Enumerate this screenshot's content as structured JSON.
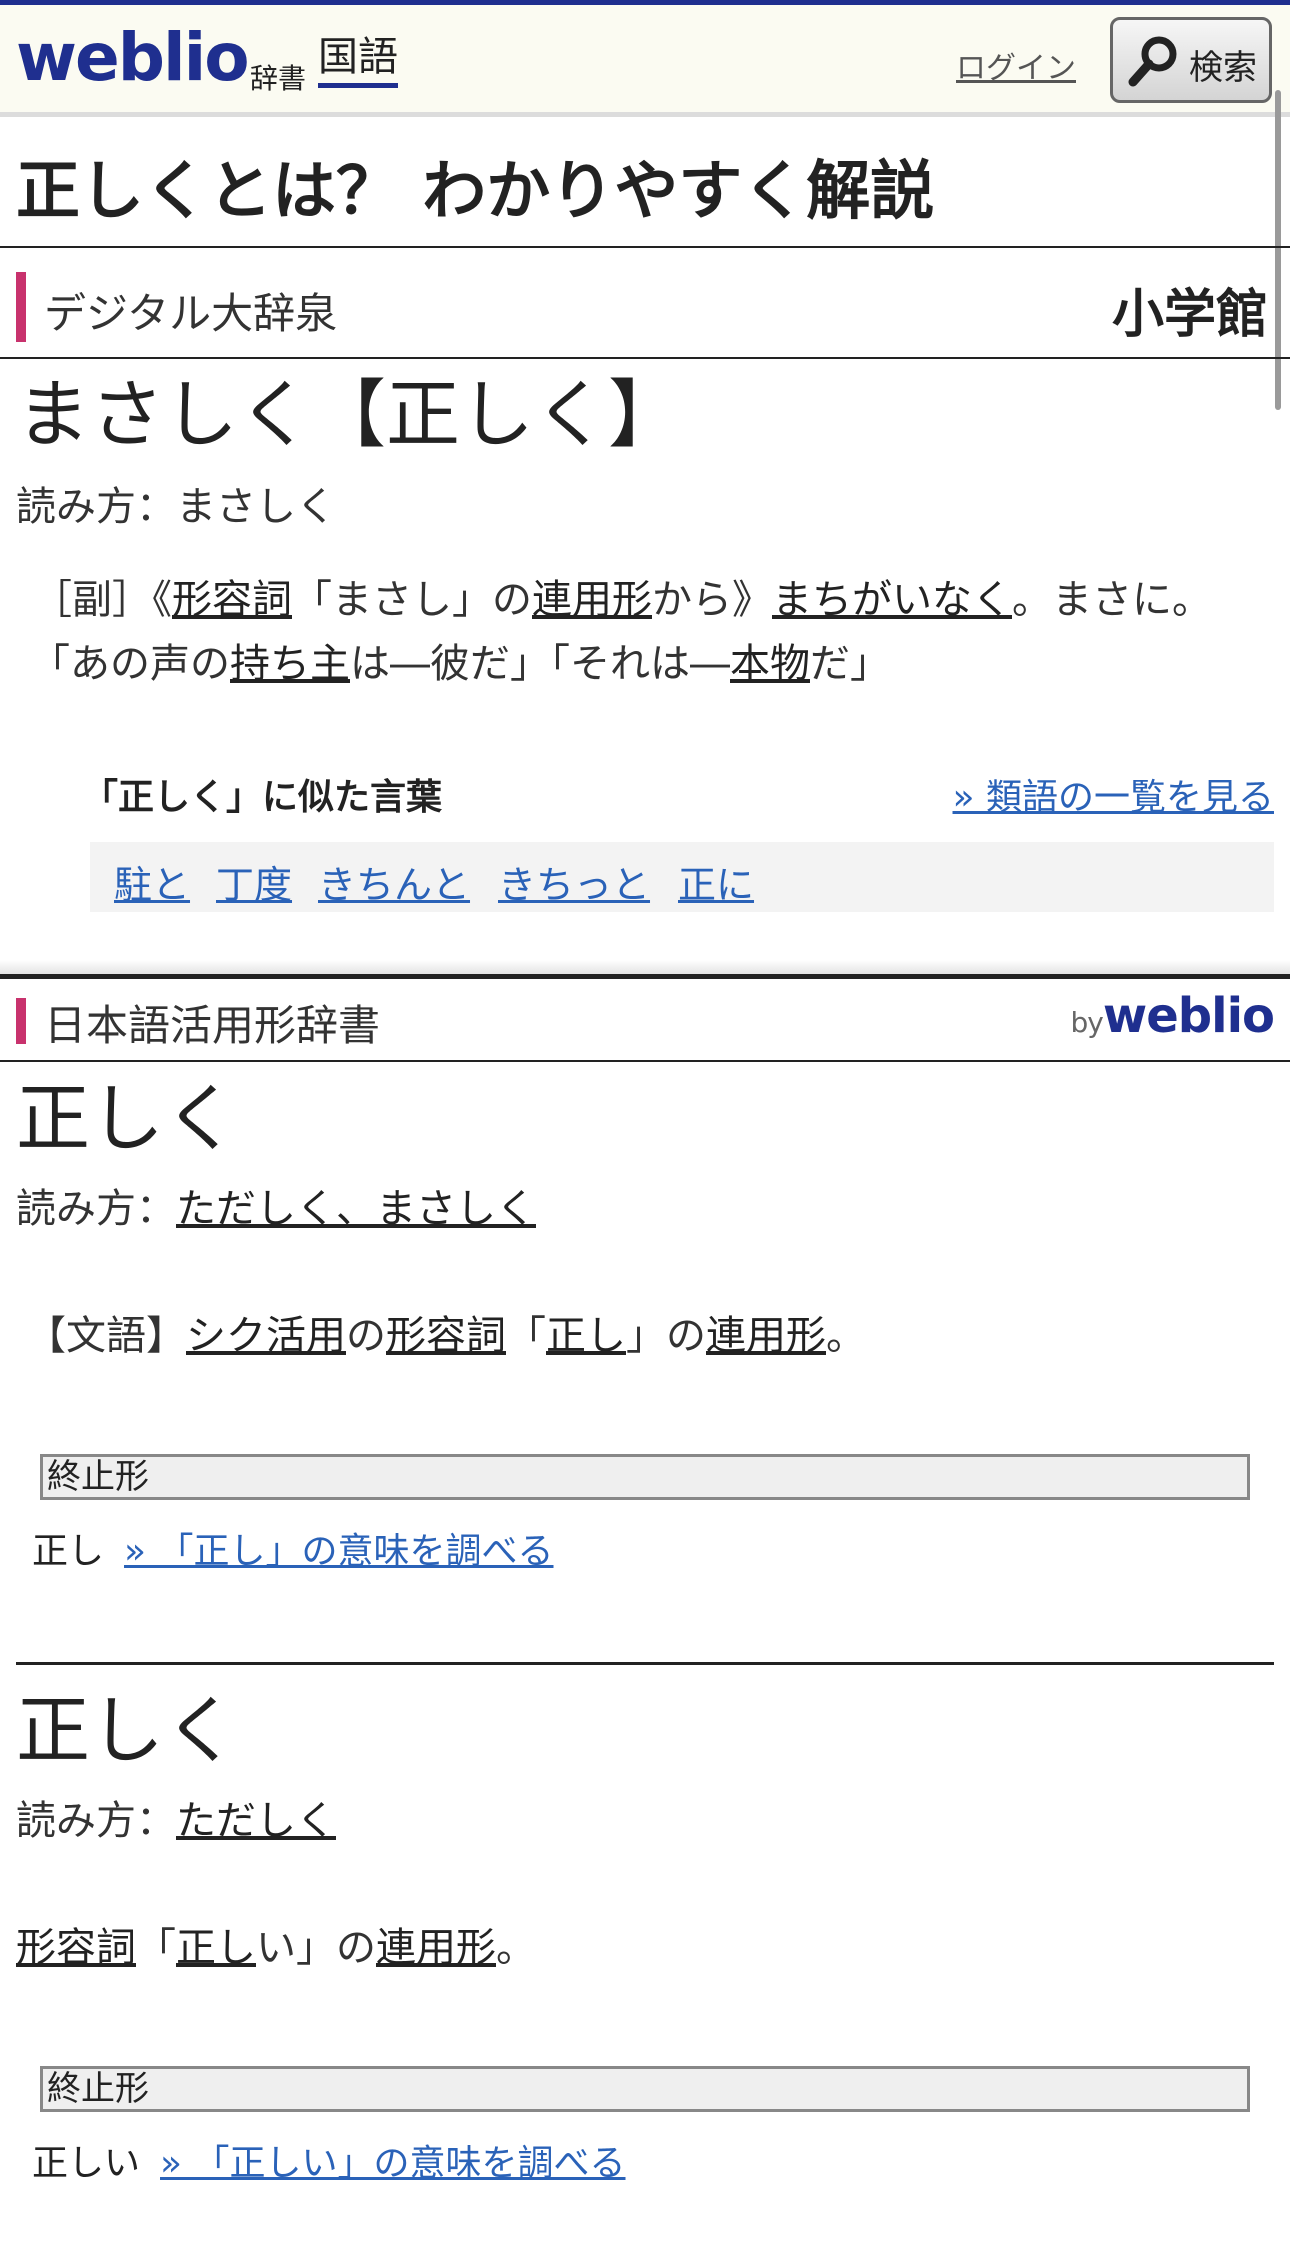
{
  "header": {
    "logo": "weblio",
    "logo_sub": "辞書",
    "category": "国語",
    "login": "ログイン",
    "search_label": "検索"
  },
  "page_title": "正しくとは？ わかりやすく解説",
  "section1": {
    "dict_name": "デジタル大辞泉",
    "publisher": "小学館",
    "headword": "まさしく【正しく】",
    "reading_label": "読み方：",
    "reading": "まさしく",
    "def_line1": {
      "pre": "［副］《",
      "l1": "形容詞",
      "t1": "「まさし」の",
      "l2": "連用形",
      "t2": "から》",
      "l3": "まちがいなく",
      "t3": "。まさに。"
    },
    "def_line2": {
      "t1": "「あの声の",
      "l1": "持ち主",
      "t2": "は―彼だ」「それは―",
      "l2": "本物",
      "t3": "だ」"
    },
    "similar_title": "「正しく」に似た言葉",
    "similar_more": "» 類語の一覧を見る",
    "similar_words": [
      "駐と",
      "丁度",
      "きちんと",
      "きちっと",
      "正に"
    ]
  },
  "section2": {
    "dict_name": "日本語活用形辞書",
    "by_label": "by",
    "by_brand": "weblio",
    "entries": [
      {
        "headword": "正しく",
        "reading_label": "読み方：",
        "reading": "ただしく、まさしく",
        "def": {
          "t0": "【文語】",
          "l1": "シク活用",
          "t1": "の",
          "l2": "形容詞",
          "t2": "「",
          "l3": "正し",
          "t3": "」の",
          "l4": "連用形",
          "t4": "。"
        },
        "table_header": "終止形",
        "form": "正し",
        "form_link": "» 「正し」の意味を調べる"
      },
      {
        "headword": "正しく",
        "reading_label": "読み方：",
        "reading": "ただしく",
        "def": {
          "l1": "形容詞",
          "t1": "「",
          "l2": "正し",
          "t2": "い」の",
          "l3": "連用形",
          "t3": "。"
        },
        "table_header": "終止形",
        "form": "正しい",
        "form_link": "» 「正しい」の意味を調べる"
      }
    ]
  }
}
